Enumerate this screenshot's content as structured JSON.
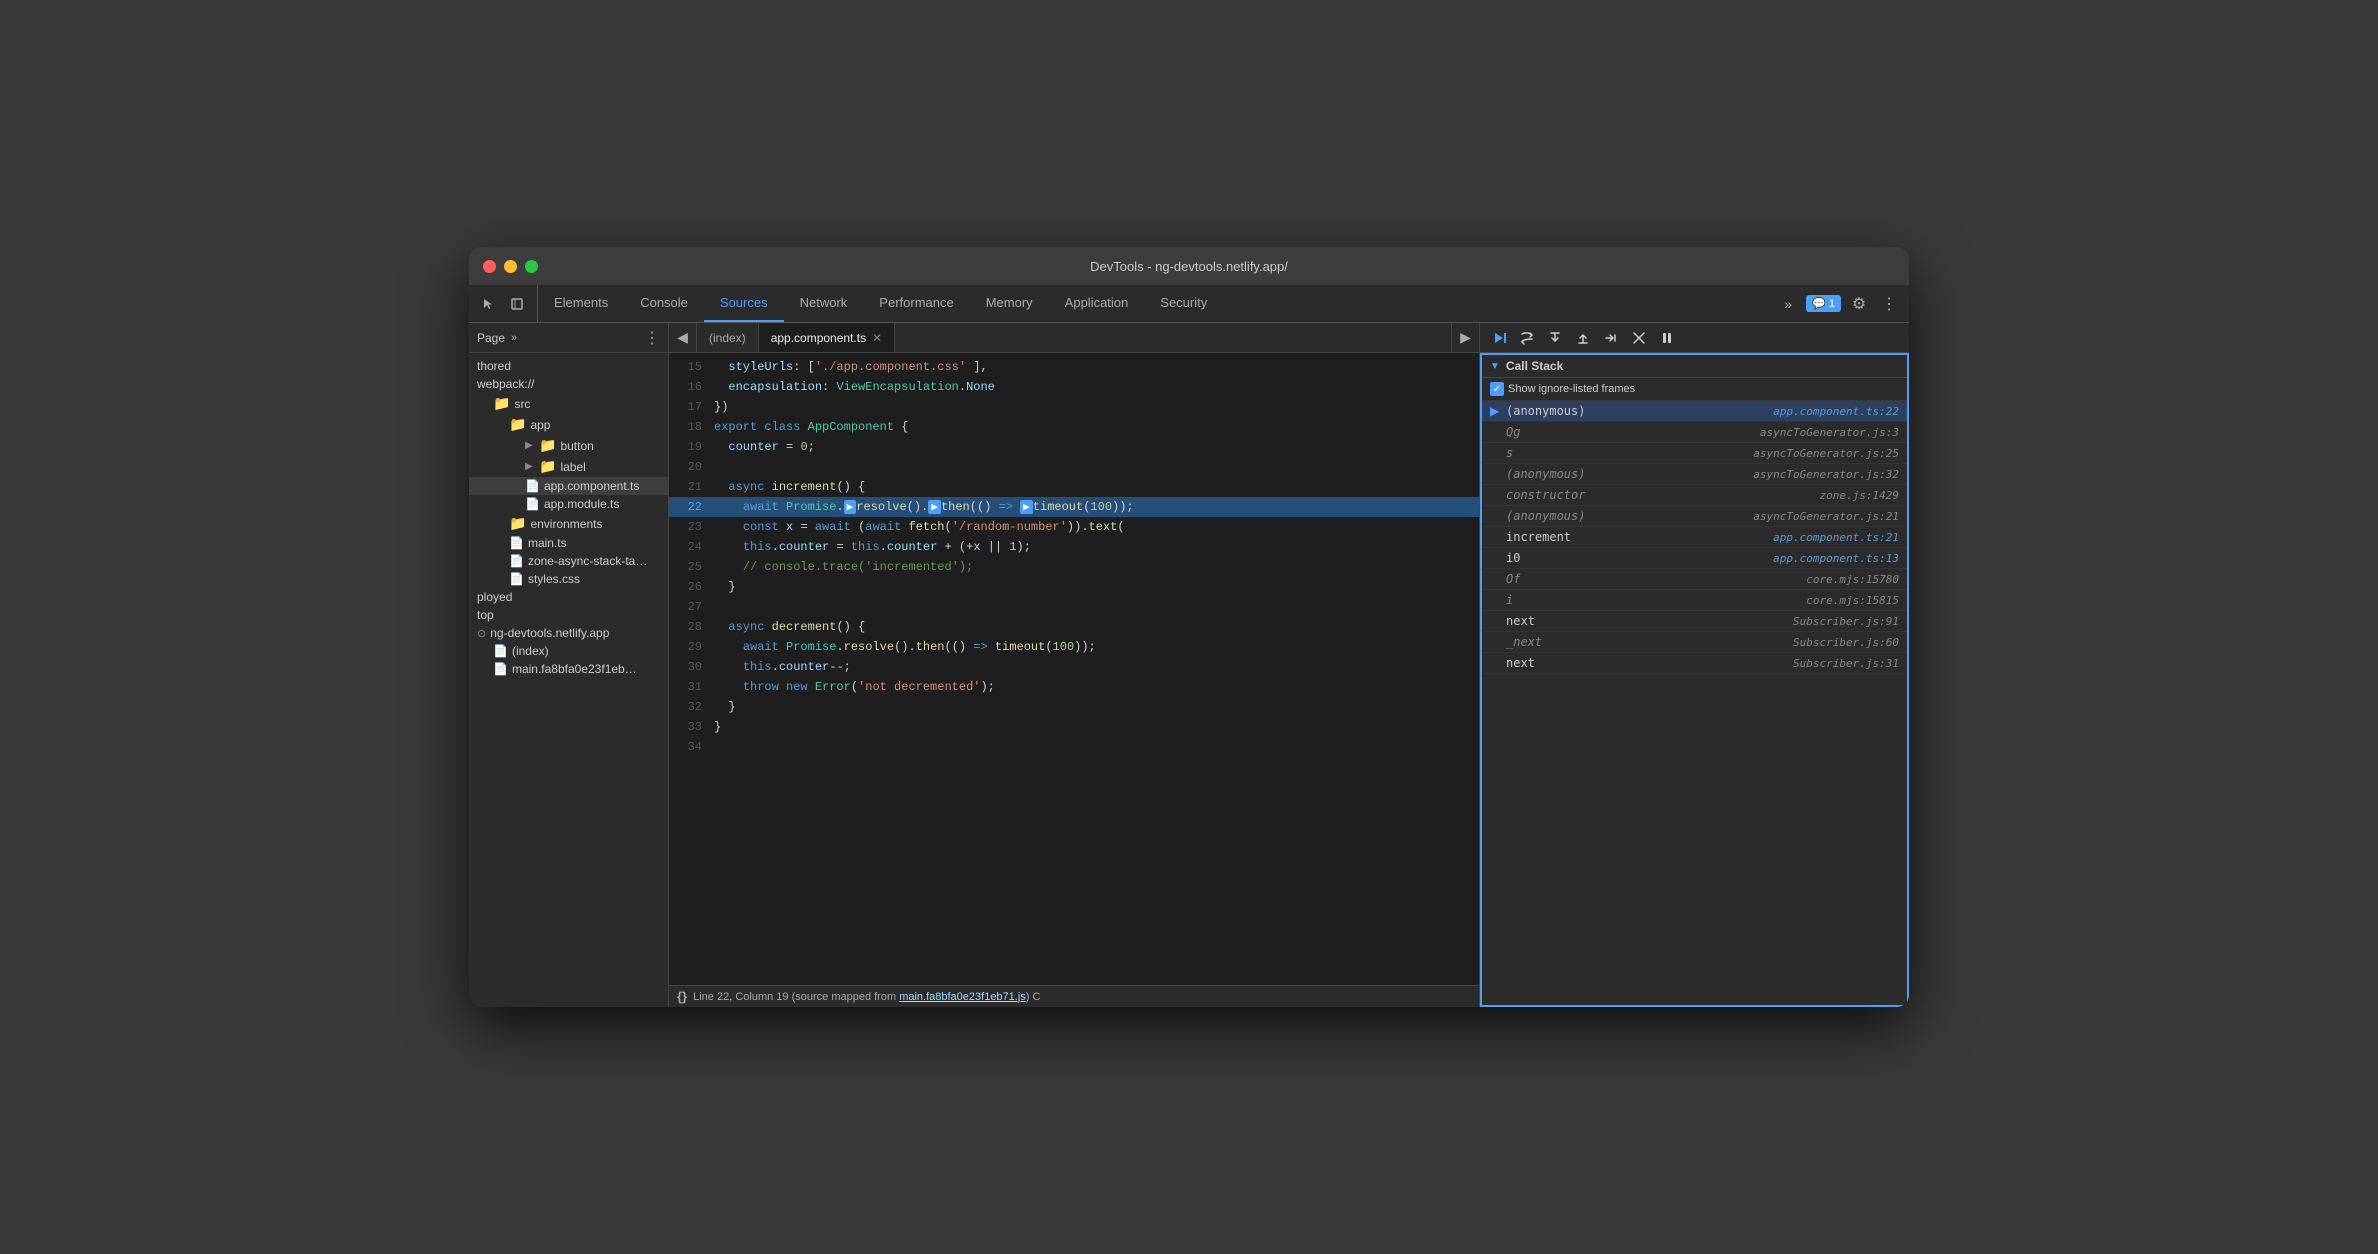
{
  "window": {
    "title": "DevTools - ng-devtools.netlify.app/"
  },
  "tabs": {
    "items": [
      {
        "label": "Elements",
        "active": false
      },
      {
        "label": "Console",
        "active": false
      },
      {
        "label": "Sources",
        "active": true
      },
      {
        "label": "Network",
        "active": false
      },
      {
        "label": "Performance",
        "active": false
      },
      {
        "label": "Memory",
        "active": false
      },
      {
        "label": "Application",
        "active": false
      },
      {
        "label": "Security",
        "active": false
      }
    ],
    "more_label": "»",
    "notification": "1",
    "notification_icon": "💬"
  },
  "sidebar": {
    "tab_label": "Page",
    "more_label": "»",
    "items": [
      {
        "label": "thored",
        "indent": 0,
        "type": "text"
      },
      {
        "label": "webpack://",
        "indent": 0,
        "type": "text"
      },
      {
        "label": "src",
        "indent": 1,
        "type": "orange-folder",
        "expanded": true
      },
      {
        "label": "app",
        "indent": 2,
        "type": "blue-folder",
        "expanded": true
      },
      {
        "label": "button",
        "indent": 3,
        "type": "blue-folder",
        "arrow": true
      },
      {
        "label": "label",
        "indent": 3,
        "type": "blue-folder",
        "arrow": true
      },
      {
        "label": "app.component.ts",
        "indent": 3,
        "type": "gray-file",
        "selected": true
      },
      {
        "label": "app.module.ts",
        "indent": 3,
        "type": "gray-file"
      },
      {
        "label": "environments",
        "indent": 2,
        "type": "blue-folder"
      },
      {
        "label": "main.ts",
        "indent": 2,
        "type": "gray-file"
      },
      {
        "label": "zone-async-stack-ta…",
        "indent": 2,
        "type": "gray-file"
      },
      {
        "label": "styles.css",
        "indent": 2,
        "type": "purple-file"
      },
      {
        "label": "ployed",
        "indent": 0,
        "type": "text"
      },
      {
        "label": "top",
        "indent": 0,
        "type": "text"
      },
      {
        "label": "ng-devtools.netlify.app",
        "indent": 0,
        "type": "domain"
      },
      {
        "label": "(index)",
        "indent": 1,
        "type": "gray-file"
      },
      {
        "label": "main.fa8bfa0e23f1eb…",
        "indent": 1,
        "type": "gray-file"
      }
    ]
  },
  "code_editor": {
    "tabs": [
      {
        "label": "(index)",
        "active": false
      },
      {
        "label": "app.component.ts",
        "active": true,
        "closeable": true
      }
    ],
    "lines": [
      {
        "num": "15",
        "content": "  styleUrls: ['./app.component.css' ],"
      },
      {
        "num": "16",
        "content": "  encapsulation: ViewEncapsulation.None"
      },
      {
        "num": "17",
        "content": "})"
      },
      {
        "num": "18",
        "content": "export class AppComponent {"
      },
      {
        "num": "19",
        "content": "  counter = 0;"
      },
      {
        "num": "20",
        "content": ""
      },
      {
        "num": "21",
        "content": "  async increment() {"
      },
      {
        "num": "22",
        "content": "    await Promise.resolve().then(() => timeout(100));",
        "highlighted": true,
        "breakpoint": true
      },
      {
        "num": "23",
        "content": "    const x = await (await fetch('/random-number')).text("
      },
      {
        "num": "24",
        "content": "    this.counter = this.counter + (+x || 1);"
      },
      {
        "num": "25",
        "content": "    // console.trace('incremented');"
      },
      {
        "num": "26",
        "content": "  }"
      },
      {
        "num": "27",
        "content": ""
      },
      {
        "num": "28",
        "content": "  async decrement() {"
      },
      {
        "num": "29",
        "content": "    await Promise.resolve().then(() => timeout(100));"
      },
      {
        "num": "30",
        "content": "    this.counter--;"
      },
      {
        "num": "31",
        "content": "    throw new Error('not decremented');"
      },
      {
        "num": "32",
        "content": "  }"
      },
      {
        "num": "33",
        "content": "}"
      },
      {
        "num": "34",
        "content": ""
      }
    ],
    "status_bar": {
      "text": "Line 22, Column 19 (source mapped from main.fa8bfa0e23f1eb71.js)",
      "link": "main.fa8bfa0e23f1eb71.js"
    }
  },
  "debugger": {
    "buttons": [
      "▶",
      "↺",
      "↓",
      "↑",
      "↔",
      "⊘",
      "⏸"
    ],
    "call_stack": {
      "title": "Call Stack",
      "show_ignored_label": "Show ignore-listed frames",
      "items": [
        {
          "name": "(anonymous)",
          "loc": "app.component.ts:22",
          "active": true,
          "italic": false
        },
        {
          "name": "Qg",
          "loc": "asyncToGenerator.js:3",
          "italic": true
        },
        {
          "name": "s",
          "loc": "asyncToGenerator.js:25",
          "italic": true
        },
        {
          "name": "(anonymous)",
          "loc": "asyncToGenerator.js:32",
          "italic": true
        },
        {
          "name": "constructor",
          "loc": "zone.js:1429",
          "italic": true
        },
        {
          "name": "(anonymous)",
          "loc": "asyncToGenerator.js:21",
          "italic": true
        },
        {
          "name": "increment",
          "loc": "app.component.ts:21",
          "italic": false
        },
        {
          "name": "i0",
          "loc": "app.component.ts:13",
          "italic": false
        },
        {
          "name": "Of",
          "loc": "core.mjs:15780",
          "italic": true
        },
        {
          "name": "i",
          "loc": "core.mjs:15815",
          "italic": true
        },
        {
          "name": "next",
          "loc": "Subscriber.js:91",
          "italic": false
        },
        {
          "name": "_next",
          "loc": "Subscriber.js:60",
          "italic": true
        },
        {
          "name": "next",
          "loc": "Subscriber.js:31",
          "italic": false
        }
      ]
    }
  }
}
